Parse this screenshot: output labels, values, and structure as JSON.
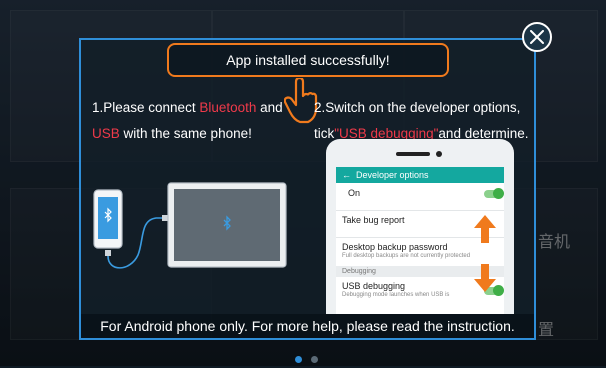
{
  "dialog": {
    "banner": "App installed successfully!",
    "step1": {
      "a": "1.Please connect ",
      "b": "Bluetooth",
      "c": " and",
      "d": "USB",
      "e": " with the same phone!"
    },
    "step2": {
      "a": "2.Switch on the developer options,",
      "b": "tick",
      "c": "\"USB debugging\"",
      "d": "and determine."
    },
    "footer": "For Android phone only. For more help, please read the instruction.",
    "phone_screen": {
      "title": "Developer options",
      "on_label": "On",
      "bug_report": "Take bug report",
      "backup_title": "Desktop backup password",
      "backup_sub": "Full desktop backups are not currently protected",
      "section": "Debugging",
      "usb_title": "USB debugging",
      "usb_sub": "Debugging mode launches when USB is"
    }
  },
  "background": {
    "fragment_1": "音机",
    "fragment_2": "置"
  },
  "pager": {
    "count": 2,
    "active": 0
  },
  "colors": {
    "accent_blue": "#2f8ed8",
    "accent_orange": "#f07a1d",
    "highlight_red": "#ef3a4a",
    "toggle_green": "#3fae47"
  }
}
